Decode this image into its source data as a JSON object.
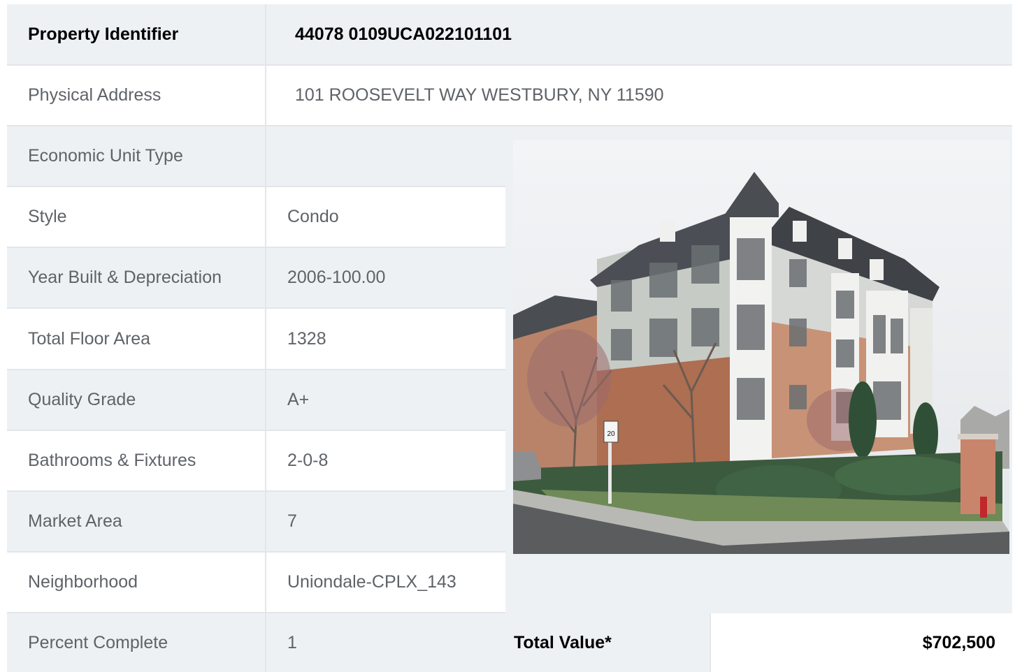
{
  "header": {
    "label": "Property Identifier",
    "value": "44078  0109UCA022101101"
  },
  "address": {
    "label": "Physical Address",
    "value": "101  ROOSEVELT WAY  WESTBURY, NY  11590"
  },
  "rows": [
    {
      "label": "Economic Unit Type",
      "value": ""
    },
    {
      "label": "Style",
      "value": "Condo"
    },
    {
      "label": "Year Built & Depreciation",
      "value": "2006-100.00"
    },
    {
      "label": "Total Floor Area",
      "value": "1328"
    },
    {
      "label": "Quality Grade",
      "value": "A+"
    },
    {
      "label": "Bathrooms & Fixtures",
      "value": "2-0-8"
    },
    {
      "label": "Market Area",
      "value": "7"
    },
    {
      "label": "Neighborhood",
      "value": "Uniondale-CPLX_143"
    },
    {
      "label": "Percent Complete",
      "value": "1"
    }
  ],
  "total": {
    "label": "Total Value*",
    "value": "$702,500"
  },
  "photo": {
    "sign_number": "20"
  },
  "colors": {
    "shade": "#eef1f4",
    "border": "#e2e6ea",
    "label_text": "#5f6368",
    "strong_text": "#000000"
  }
}
